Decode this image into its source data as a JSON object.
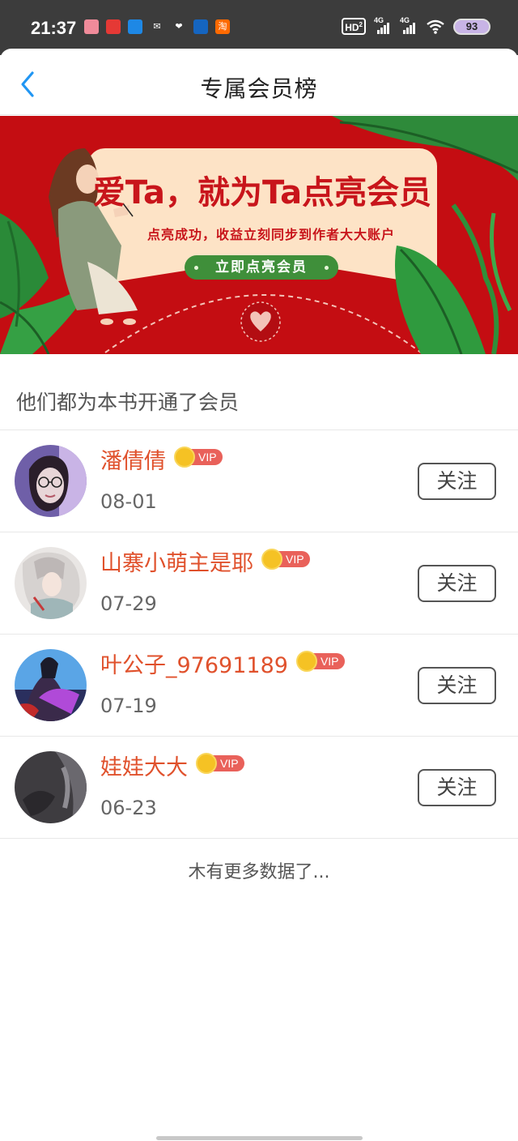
{
  "status_bar": {
    "time": "21:37",
    "apps": [
      {
        "icon": "app-1-icon",
        "glyph": "●",
        "color": "#f08b9a"
      },
      {
        "icon": "app-2-icon",
        "glyph": "●",
        "color": "#e53935"
      },
      {
        "icon": "app-3-icon",
        "glyph": "●",
        "color": "#1e88e5"
      },
      {
        "icon": "wechat-icon",
        "glyph": "✉",
        "color": "#3c3c3c"
      },
      {
        "icon": "heart-icon",
        "glyph": "❤",
        "color": "#3c3c3c"
      },
      {
        "icon": "app-6-icon",
        "glyph": "●",
        "color": "#1565c0"
      },
      {
        "icon": "taobao-icon",
        "glyph": "淘",
        "color": "#ff6a00"
      }
    ],
    "hd": "HD",
    "hd_sub": "2",
    "network_1": "4G",
    "network_2": "4G",
    "battery": "93"
  },
  "header": {
    "title": "专属会员榜"
  },
  "banner": {
    "title": "爱Ta，就为Ta点亮会员",
    "subtitle": "点亮成功，收益立刻同步到作者大大账户",
    "button_label": "立即点亮会员"
  },
  "section": {
    "title": "他们都为本书开通了会员"
  },
  "vip_text": "VIP",
  "follow_label": "关注",
  "members": [
    {
      "name": "潘倩倩",
      "date": "08-01"
    },
    {
      "name": "山寨小萌主是耶",
      "date": "07-29"
    },
    {
      "name": "叶公子_97691189",
      "date": "07-19"
    },
    {
      "name": "娃娃大大",
      "date": "06-23"
    }
  ],
  "footer": {
    "no_more": "木有更多数据了..."
  },
  "colors": {
    "accent_name": "#e0512c",
    "back_arrow": "#2196f3",
    "banner_red": "#c40d12",
    "vip_badge": "#e9615a"
  }
}
